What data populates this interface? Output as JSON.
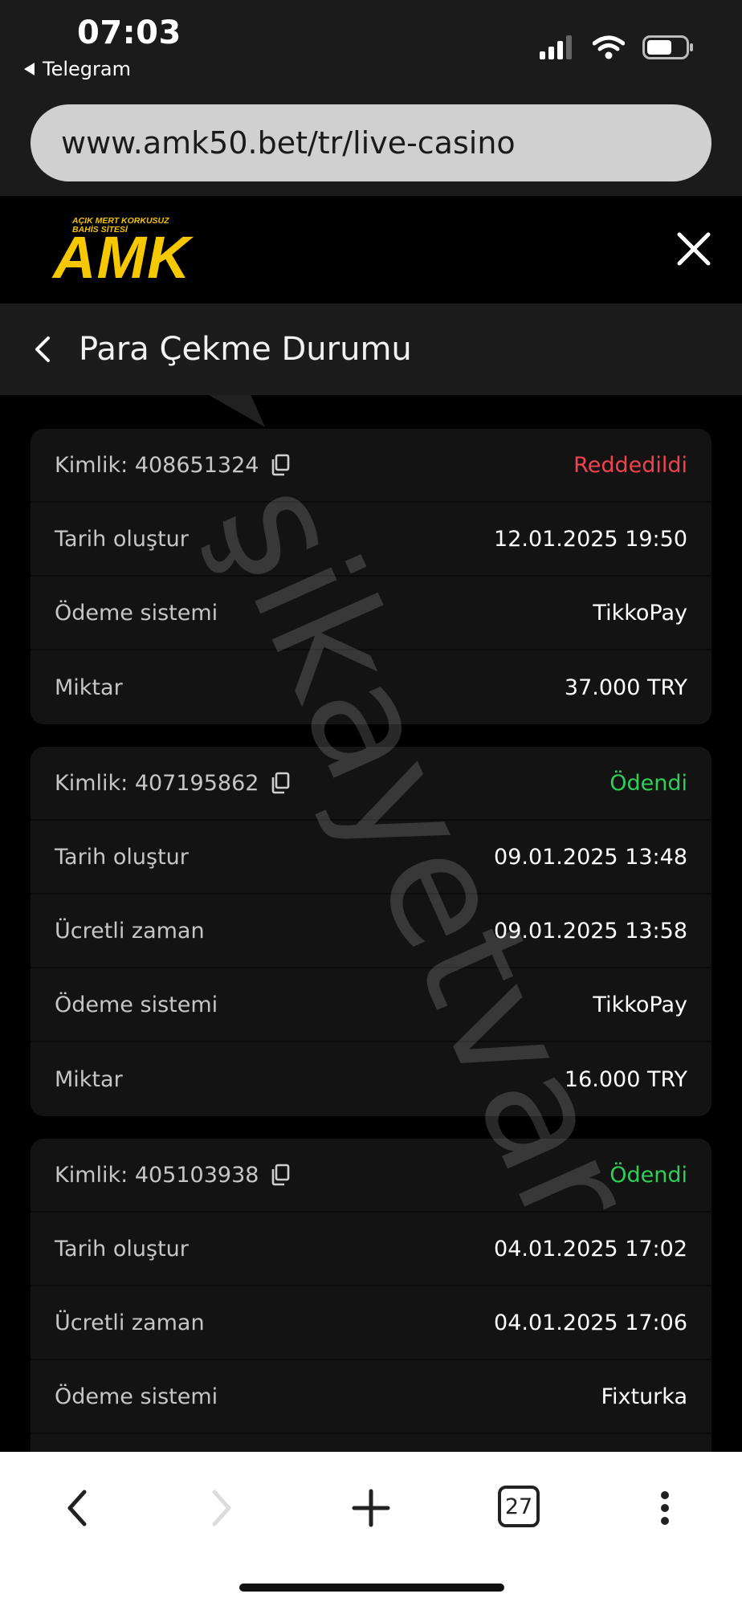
{
  "status_bar": {
    "time": "07:03",
    "back_app": "Telegram"
  },
  "browser": {
    "url": "www.amk50.bet/tr/live-casino",
    "tab_count": "27"
  },
  "header": {
    "logo_tagline_1": "AÇIK MERT KORKUSUZ",
    "logo_tagline_2": "BAHİS SİTESİ",
    "logo_text": "AMK"
  },
  "page": {
    "title": "Para Çekme Durumu"
  },
  "watermark": "şikayetvar",
  "colors": {
    "rejected": "#f0434d",
    "paid": "#2fcf57",
    "logo": "#f5c800"
  },
  "withdrawals": [
    {
      "id_label": "Kimlik: 408651324",
      "status": "Reddedildi",
      "rows": [
        {
          "label": "Tarih oluştur",
          "value": "12.01.2025 19:50"
        },
        {
          "label": "Ödeme sistemi",
          "value": "TikkoPay"
        },
        {
          "label": "Miktar",
          "value": "37.000 TRY"
        }
      ]
    },
    {
      "id_label": "Kimlik: 407195862",
      "status": "Ödendi",
      "rows": [
        {
          "label": "Tarih oluştur",
          "value": "09.01.2025 13:48"
        },
        {
          "label": "Ücretli zaman",
          "value": "09.01.2025 13:58"
        },
        {
          "label": "Ödeme sistemi",
          "value": "TikkoPay"
        },
        {
          "label": "Miktar",
          "value": "16.000 TRY"
        }
      ]
    },
    {
      "id_label": "Kimlik: 405103938",
      "status": "Ödendi",
      "rows": [
        {
          "label": "Tarih oluştur",
          "value": "04.01.2025 17:02"
        },
        {
          "label": "Ücretli zaman",
          "value": "04.01.2025 17:06"
        },
        {
          "label": "Ödeme sistemi",
          "value": "Fixturka"
        },
        {
          "label": "",
          "value": ""
        }
      ]
    }
  ]
}
